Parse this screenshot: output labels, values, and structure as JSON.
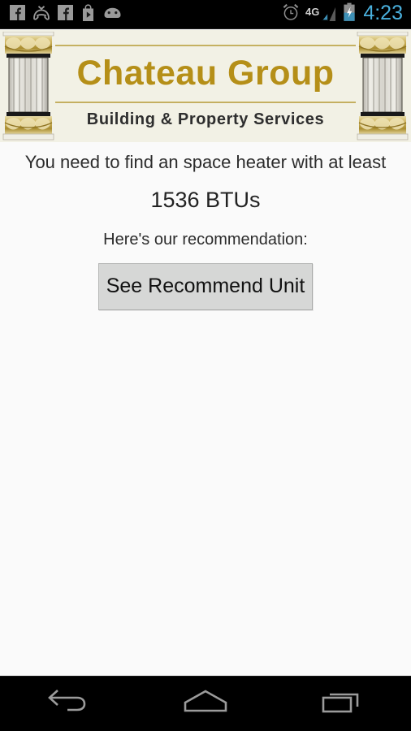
{
  "status_bar": {
    "left_icons": [
      {
        "name": "facebook-notification-icon",
        "label": "f"
      },
      {
        "name": "missed-call-icon",
        "label": "missed call"
      },
      {
        "name": "facebook-notification-icon-2",
        "label": "f"
      },
      {
        "name": "play-store-icon",
        "label": "Play Store"
      },
      {
        "name": "android-system-icon",
        "label": "Android"
      }
    ],
    "alarm_icon": "alarm-clock-icon",
    "network_label": "4G",
    "signal_icon": "signal-bars-icon",
    "battery_icon": "battery-charging-icon",
    "time": "4:23"
  },
  "banner": {
    "title": "Chateau Group",
    "tagline": "Building & Property Services",
    "column_left": "decorative-column-left",
    "column_right": "decorative-column-right",
    "colors": {
      "background": "#f2f1e5",
      "title": "#b58f18",
      "rule": "#b9a249",
      "tagline": "#2e2e2e"
    }
  },
  "content": {
    "headline": "You need to find an space heater with at least",
    "btu_value": "1536 BTUs",
    "recommendation_label": "Here's our recommendation:",
    "button_label": "See Recommend Unit",
    "colors": {
      "background": "#fafafa",
      "button_background": "#d6d7d6",
      "button_border": "#b5b6b5"
    }
  },
  "nav_bar": {
    "back_label": "Back",
    "home_label": "Home",
    "recents_label": "Recent apps",
    "colors": {
      "background": "#000000",
      "icon": "#9b9b9b"
    }
  }
}
